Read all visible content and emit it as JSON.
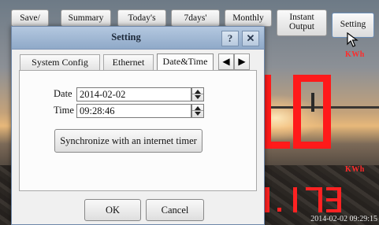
{
  "top_buttons": {
    "save": "Save/",
    "summary": "Summary",
    "todays": "Today's",
    "seven_days": "7days'",
    "monthly": "Monthly",
    "instant_output_line1": "Instant",
    "instant_output_line2": "Output",
    "setting": "Setting"
  },
  "background": {
    "kwh_top": "KWh",
    "kwh_bottom": "KWh",
    "timestamp": "2014-02-02 09:29:15",
    "display_color": "#ff1a1a"
  },
  "dialog": {
    "title": "Setting",
    "help_button": "?",
    "close_button": "✕",
    "tabs": [
      "System Config",
      "Ethernet",
      "Date&Time"
    ],
    "active_tab": "Date&Time",
    "scroll_left": "◀",
    "scroll_right": "▶",
    "date_label": "Date",
    "date_value": "2014-02-02",
    "time_label": "Time",
    "time_value": "09:28:46",
    "sync_button": "Synchronize with an internet timer",
    "ok_button": "OK",
    "cancel_button": "Cancel"
  }
}
